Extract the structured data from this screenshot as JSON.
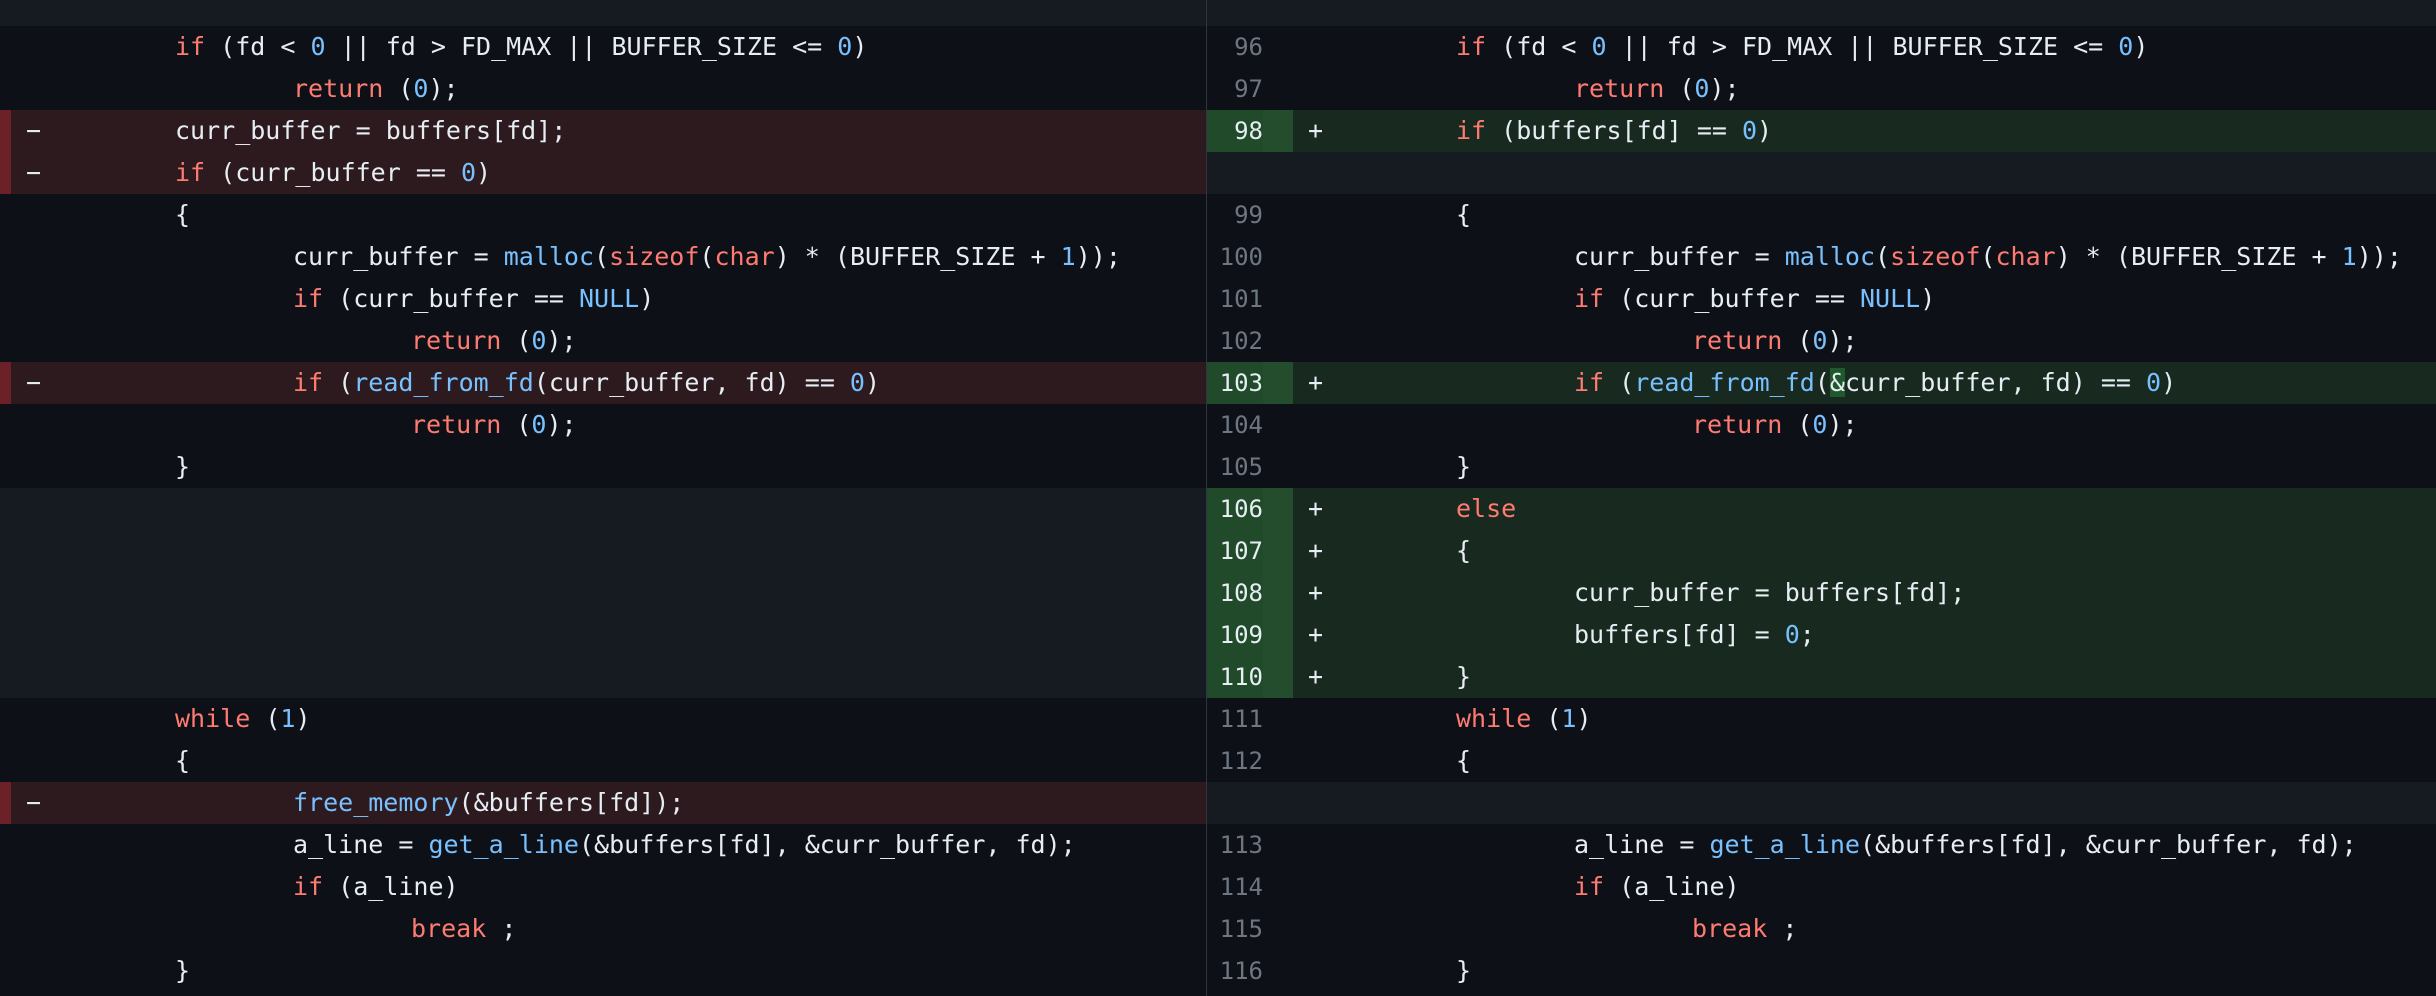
{
  "left_rows": [
    {
      "type": "ctx",
      "marker": "",
      "line": "",
      "indent": 1,
      "tokens": [
        [
          "kw",
          "if"
        ],
        [
          "p",
          " (fd < "
        ],
        [
          "num",
          "0"
        ],
        [
          "p",
          " || fd > FD_MAX || BUFFER_SIZE <= "
        ],
        [
          "num",
          "0"
        ],
        [
          "p",
          ")"
        ]
      ]
    },
    {
      "type": "ctx",
      "marker": "",
      "line": "",
      "indent": 2,
      "tokens": [
        [
          "kw",
          "return"
        ],
        [
          "p",
          " ("
        ],
        [
          "num",
          "0"
        ],
        [
          "p",
          ");"
        ]
      ]
    },
    {
      "type": "del",
      "marker": "−",
      "line": "",
      "indent": 1,
      "tokens": [
        [
          "p",
          "curr_buffer = buffers[fd];"
        ]
      ]
    },
    {
      "type": "del",
      "marker": "−",
      "line": "",
      "indent": 1,
      "tokens": [
        [
          "kw",
          "if"
        ],
        [
          "p",
          " (curr_buffer == "
        ],
        [
          "num",
          "0"
        ],
        [
          "p",
          ")"
        ]
      ]
    },
    {
      "type": "ctx",
      "marker": "",
      "line": "",
      "indent": 1,
      "tokens": [
        [
          "p",
          "{"
        ]
      ]
    },
    {
      "type": "ctx",
      "marker": "",
      "line": "",
      "indent": 2,
      "tokens": [
        [
          "p",
          "curr_buffer = "
        ],
        [
          "fn",
          "malloc"
        ],
        [
          "p",
          "("
        ],
        [
          "kw",
          "sizeof"
        ],
        [
          "p",
          "("
        ],
        [
          "kw",
          "char"
        ],
        [
          "p",
          ") * (BUFFER_SIZE + "
        ],
        [
          "num",
          "1"
        ],
        [
          "p",
          "));"
        ]
      ]
    },
    {
      "type": "ctx",
      "marker": "",
      "line": "",
      "indent": 2,
      "tokens": [
        [
          "kw",
          "if"
        ],
        [
          "p",
          " (curr_buffer == "
        ],
        [
          "num",
          "NULL"
        ],
        [
          "p",
          ")"
        ]
      ]
    },
    {
      "type": "ctx",
      "marker": "",
      "line": "",
      "indent": 3,
      "tokens": [
        [
          "kw",
          "return"
        ],
        [
          "p",
          " ("
        ],
        [
          "num",
          "0"
        ],
        [
          "p",
          ");"
        ]
      ]
    },
    {
      "type": "del",
      "marker": "−",
      "line": "",
      "indent": 2,
      "tokens": [
        [
          "kw",
          "if"
        ],
        [
          "p",
          " ("
        ],
        [
          "fn",
          "read_from_fd"
        ],
        [
          "p",
          "(curr_buffer, fd) == "
        ],
        [
          "num",
          "0"
        ],
        [
          "p",
          ")"
        ]
      ]
    },
    {
      "type": "ctx",
      "marker": "",
      "line": "",
      "indent": 3,
      "tokens": [
        [
          "kw",
          "return"
        ],
        [
          "p",
          " ("
        ],
        [
          "num",
          "0"
        ],
        [
          "p",
          ");"
        ]
      ]
    },
    {
      "type": "ctx",
      "marker": "",
      "line": "",
      "indent": 1,
      "tokens": [
        [
          "p",
          "}"
        ]
      ]
    },
    {
      "type": "empty",
      "marker": "",
      "line": "",
      "indent": 0,
      "tokens": []
    },
    {
      "type": "empty",
      "marker": "",
      "line": "",
      "indent": 0,
      "tokens": []
    },
    {
      "type": "empty",
      "marker": "",
      "line": "",
      "indent": 0,
      "tokens": []
    },
    {
      "type": "empty",
      "marker": "",
      "line": "",
      "indent": 0,
      "tokens": []
    },
    {
      "type": "empty",
      "marker": "",
      "line": "",
      "indent": 0,
      "tokens": []
    },
    {
      "type": "ctx",
      "marker": "",
      "line": "",
      "indent": 1,
      "tokens": [
        [
          "kw",
          "while"
        ],
        [
          "p",
          " ("
        ],
        [
          "num",
          "1"
        ],
        [
          "p",
          ")"
        ]
      ]
    },
    {
      "type": "ctx",
      "marker": "",
      "line": "",
      "indent": 1,
      "tokens": [
        [
          "p",
          "{"
        ]
      ]
    },
    {
      "type": "del",
      "marker": "−",
      "line": "",
      "indent": 2,
      "tokens": [
        [
          "fn",
          "free_memory"
        ],
        [
          "p",
          "(&buffers[fd]);"
        ]
      ]
    },
    {
      "type": "ctx",
      "marker": "",
      "line": "",
      "indent": 2,
      "tokens": [
        [
          "p",
          "a_line = "
        ],
        [
          "fn",
          "get_a_line"
        ],
        [
          "p",
          "(&buffers[fd], &curr_buffer, fd);"
        ]
      ]
    },
    {
      "type": "ctx",
      "marker": "",
      "line": "",
      "indent": 2,
      "tokens": [
        [
          "kw",
          "if"
        ],
        [
          "p",
          " (a_line)"
        ]
      ]
    },
    {
      "type": "ctx",
      "marker": "",
      "line": "",
      "indent": 3,
      "tokens": [
        [
          "kw",
          "break"
        ],
        [
          "p",
          " ;"
        ]
      ]
    },
    {
      "type": "ctx",
      "marker": "",
      "line": "",
      "indent": 1,
      "tokens": [
        [
          "p",
          "}"
        ]
      ]
    }
  ],
  "right_rows": [
    {
      "type": "ctx",
      "marker": "",
      "line": "96",
      "indent": 1,
      "tokens": [
        [
          "kw",
          "if"
        ],
        [
          "p",
          " (fd < "
        ],
        [
          "num",
          "0"
        ],
        [
          "p",
          " || fd > FD_MAX || BUFFER_SIZE <= "
        ],
        [
          "num",
          "0"
        ],
        [
          "p",
          ")"
        ]
      ]
    },
    {
      "type": "ctx",
      "marker": "",
      "line": "97",
      "indent": 2,
      "tokens": [
        [
          "kw",
          "return"
        ],
        [
          "p",
          " ("
        ],
        [
          "num",
          "0"
        ],
        [
          "p",
          ");"
        ]
      ]
    },
    {
      "type": "add",
      "marker": "+",
      "line": "98",
      "indent": 1,
      "tokens": [
        [
          "kw",
          "if"
        ],
        [
          "p",
          " (buffers[fd] == "
        ],
        [
          "num",
          "0"
        ],
        [
          "p",
          ")"
        ]
      ]
    },
    {
      "type": "empty",
      "marker": "",
      "line": "",
      "indent": 0,
      "tokens": []
    },
    {
      "type": "ctx",
      "marker": "",
      "line": "99",
      "indent": 1,
      "tokens": [
        [
          "p",
          "{"
        ]
      ]
    },
    {
      "type": "ctx",
      "marker": "",
      "line": "100",
      "indent": 2,
      "tokens": [
        [
          "p",
          "curr_buffer = "
        ],
        [
          "fn",
          "malloc"
        ],
        [
          "p",
          "("
        ],
        [
          "kw",
          "sizeof"
        ],
        [
          "p",
          "("
        ],
        [
          "kw",
          "char"
        ],
        [
          "p",
          ") * (BUFFER_SIZE + "
        ],
        [
          "num",
          "1"
        ],
        [
          "p",
          "));"
        ]
      ]
    },
    {
      "type": "ctx",
      "marker": "",
      "line": "101",
      "indent": 2,
      "tokens": [
        [
          "kw",
          "if"
        ],
        [
          "p",
          " (curr_buffer == "
        ],
        [
          "num",
          "NULL"
        ],
        [
          "p",
          ")"
        ]
      ]
    },
    {
      "type": "ctx",
      "marker": "",
      "line": "102",
      "indent": 3,
      "tokens": [
        [
          "kw",
          "return"
        ],
        [
          "p",
          " ("
        ],
        [
          "num",
          "0"
        ],
        [
          "p",
          ");"
        ]
      ]
    },
    {
      "type": "add",
      "marker": "+",
      "line": "103",
      "indent": 2,
      "tokens": [
        [
          "kw",
          "if"
        ],
        [
          "p",
          " ("
        ],
        [
          "fn",
          "read_from_fd"
        ],
        [
          "p",
          "("
        ],
        [
          "hl",
          "&"
        ],
        [
          "p",
          "curr_buffer, fd) == "
        ],
        [
          "num",
          "0"
        ],
        [
          "p",
          ")"
        ]
      ]
    },
    {
      "type": "ctx",
      "marker": "",
      "line": "104",
      "indent": 3,
      "tokens": [
        [
          "kw",
          "return"
        ],
        [
          "p",
          " ("
        ],
        [
          "num",
          "0"
        ],
        [
          "p",
          ");"
        ]
      ]
    },
    {
      "type": "ctx",
      "marker": "",
      "line": "105",
      "indent": 1,
      "tokens": [
        [
          "p",
          "}"
        ]
      ]
    },
    {
      "type": "add",
      "marker": "+",
      "line": "106",
      "indent": 1,
      "tokens": [
        [
          "kw",
          "else"
        ]
      ]
    },
    {
      "type": "add",
      "marker": "+",
      "line": "107",
      "indent": 1,
      "tokens": [
        [
          "p",
          "{"
        ]
      ]
    },
    {
      "type": "add",
      "marker": "+",
      "line": "108",
      "indent": 2,
      "tokens": [
        [
          "p",
          "curr_buffer = buffers[fd];"
        ]
      ]
    },
    {
      "type": "add",
      "marker": "+",
      "line": "109",
      "indent": 2,
      "tokens": [
        [
          "p",
          "buffers[fd] = "
        ],
        [
          "num",
          "0"
        ],
        [
          "p",
          ";"
        ]
      ]
    },
    {
      "type": "add",
      "marker": "+",
      "line": "110",
      "indent": 1,
      "tokens": [
        [
          "p",
          "}"
        ]
      ]
    },
    {
      "type": "ctx",
      "marker": "",
      "line": "111",
      "indent": 1,
      "tokens": [
        [
          "kw",
          "while"
        ],
        [
          "p",
          " ("
        ],
        [
          "num",
          "1"
        ],
        [
          "p",
          ")"
        ]
      ]
    },
    {
      "type": "ctx",
      "marker": "",
      "line": "112",
      "indent": 1,
      "tokens": [
        [
          "p",
          "{"
        ]
      ]
    },
    {
      "type": "empty",
      "marker": "",
      "line": "",
      "indent": 0,
      "tokens": []
    },
    {
      "type": "ctx",
      "marker": "",
      "line": "113",
      "indent": 2,
      "tokens": [
        [
          "p",
          "a_line = "
        ],
        [
          "fn",
          "get_a_line"
        ],
        [
          "p",
          "(&buffers[fd], &curr_buffer, fd);"
        ]
      ]
    },
    {
      "type": "ctx",
      "marker": "",
      "line": "114",
      "indent": 2,
      "tokens": [
        [
          "kw",
          "if"
        ],
        [
          "p",
          " (a_line)"
        ]
      ]
    },
    {
      "type": "ctx",
      "marker": "",
      "line": "115",
      "indent": 3,
      "tokens": [
        [
          "kw",
          "break"
        ],
        [
          "p",
          " ;"
        ]
      ]
    },
    {
      "type": "ctx",
      "marker": "",
      "line": "116",
      "indent": 1,
      "tokens": [
        [
          "p",
          "}"
        ]
      ]
    }
  ],
  "hunk_text": "++++++++++++++++",
  "colors": {
    "keyword": "#ff7b72",
    "function": "#79c0ff",
    "number": "#79c0ff",
    "text": "#e6edf3",
    "deleted_bg": "#2c1a1e",
    "added_bg": "#18291f"
  }
}
